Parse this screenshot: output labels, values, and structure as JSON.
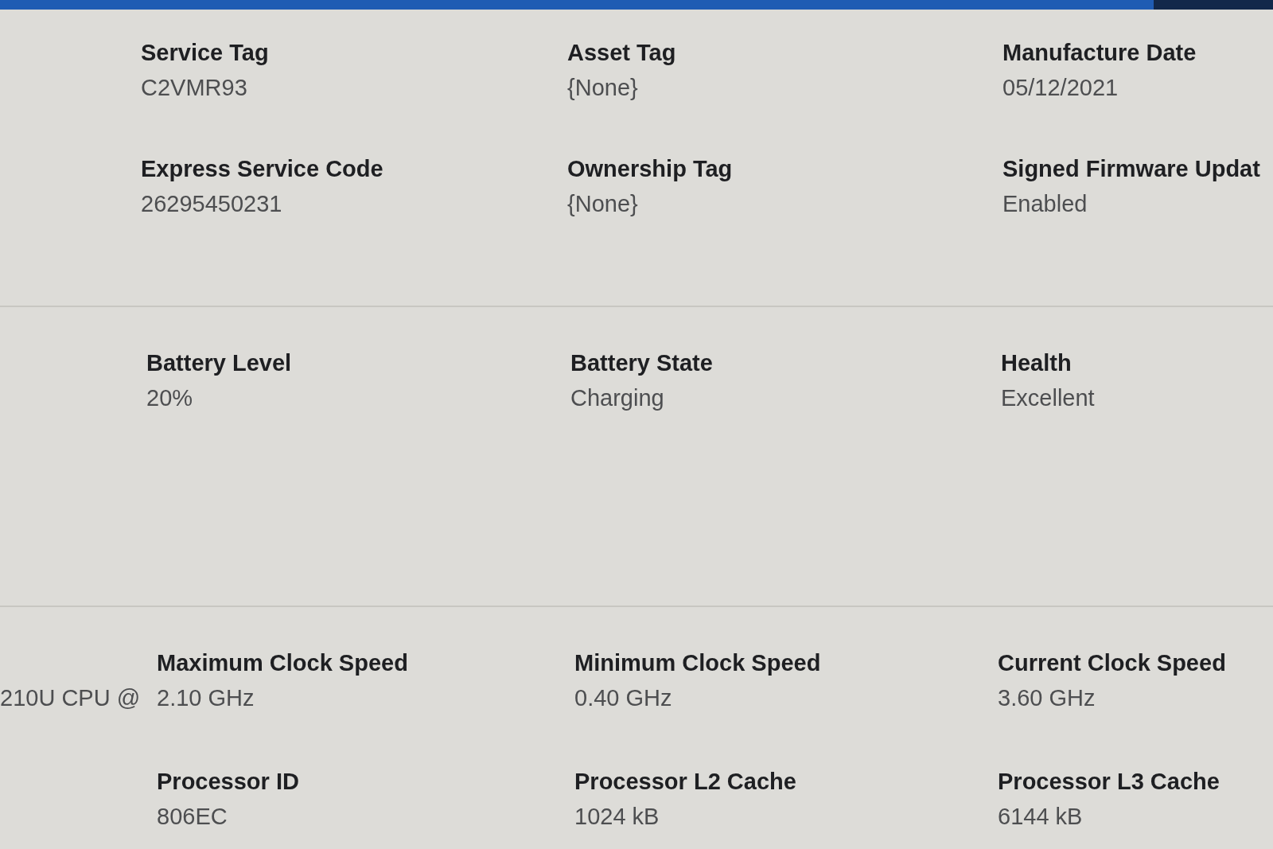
{
  "sections": [
    {
      "fields": [
        {
          "label": "Service Tag",
          "value": "C2VMR93"
        },
        {
          "label": "Asset Tag",
          "value": "{None}"
        },
        {
          "label": "Manufacture Date",
          "value": "05/12/2021"
        },
        {
          "label": "Express Service Code",
          "value": "26295450231"
        },
        {
          "label": "Ownership Tag",
          "value": "{None}"
        },
        {
          "label": "Signed Firmware Updat",
          "value": "Enabled"
        }
      ]
    },
    {
      "fields": [
        {
          "label": "Battery Level",
          "value": "20%"
        },
        {
          "label": "Battery State",
          "value": "Charging"
        },
        {
          "label": "Health",
          "value": "Excellent"
        }
      ]
    },
    {
      "cut_text": "210U CPU @",
      "fields": [
        {
          "label": "Maximum Clock Speed",
          "value": "2.10 GHz"
        },
        {
          "label": "Minimum Clock Speed",
          "value": "0.40 GHz"
        },
        {
          "label": "Current Clock Speed",
          "value": "3.60 GHz"
        },
        {
          "label": "Processor ID",
          "value": "806EC"
        },
        {
          "label": "Processor L2 Cache",
          "value": "1024 kB"
        },
        {
          "label": "Processor L3 Cache",
          "value": "6144 kB"
        }
      ]
    }
  ]
}
